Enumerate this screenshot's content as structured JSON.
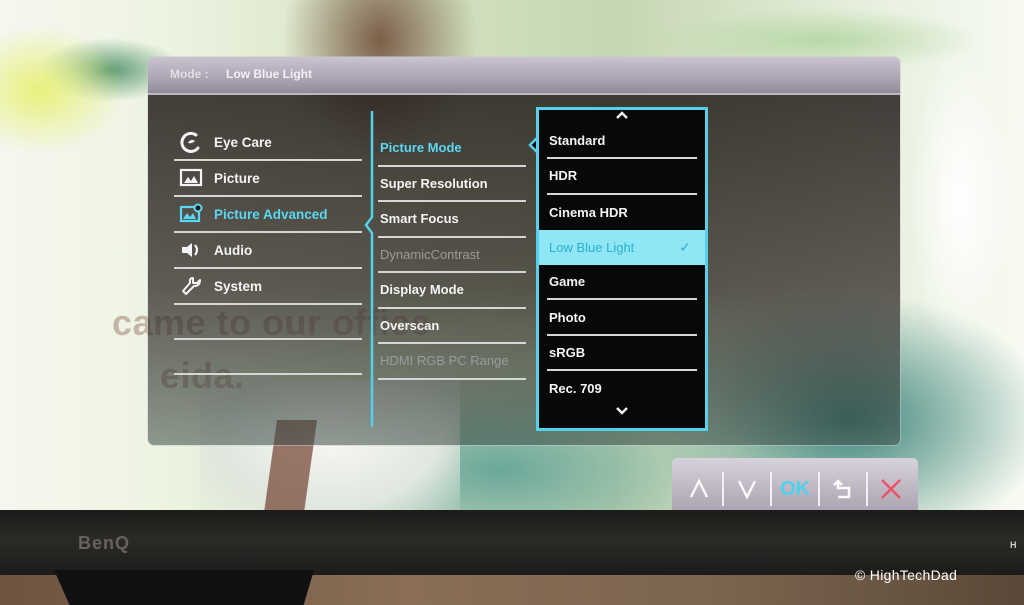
{
  "osd": {
    "header": {
      "mode_label": "Mode :",
      "mode_value": "Low Blue Light"
    },
    "main_menu": [
      {
        "label": "Eye Care",
        "icon": "eye-care-icon",
        "active": false
      },
      {
        "label": "Picture",
        "icon": "picture-icon",
        "active": false
      },
      {
        "label": "Picture Advanced",
        "icon": "picture-advanced-icon",
        "active": true
      },
      {
        "label": "Audio",
        "icon": "speaker-icon",
        "active": false
      },
      {
        "label": "System",
        "icon": "wrench-icon",
        "active": false
      }
    ],
    "sub_menu": [
      {
        "label": "Picture Mode",
        "state": "active"
      },
      {
        "label": "Super Resolution",
        "state": "normal"
      },
      {
        "label": "Smart Focus",
        "state": "normal"
      },
      {
        "label": "DynamicContrast",
        "state": "disabled"
      },
      {
        "label": "Display Mode",
        "state": "normal"
      },
      {
        "label": "Overscan",
        "state": "normal"
      },
      {
        "label": "HDMI RGB PC Range",
        "state": "disabled"
      }
    ],
    "options": {
      "scroll_up": "^",
      "scroll_down": "v",
      "items": [
        {
          "label": "Standard",
          "selected": false
        },
        {
          "label": "HDR",
          "selected": false
        },
        {
          "label": "Cinema HDR",
          "selected": false
        },
        {
          "label": "Low Blue Light",
          "selected": true
        },
        {
          "label": "Game",
          "selected": false
        },
        {
          "label": "Photo",
          "selected": false
        },
        {
          "label": "sRGB",
          "selected": false
        },
        {
          "label": "Rec. 709",
          "selected": false
        }
      ],
      "check_mark": "✓"
    }
  },
  "keybar": {
    "up": "up-key",
    "down": "down-key",
    "ok_label": "OK",
    "back": "back-key",
    "close": "close-key"
  },
  "video_subtitle": {
    "line1": "came to our office",
    "line2": "eida."
  },
  "monitor": {
    "brand": "BenQ",
    "badge": "H"
  },
  "watermark": "© HighTechDad",
  "colors": {
    "accent": "#58d8f2",
    "selected_bg": "#8fe6f4",
    "close_red": "#f0506a",
    "header_bg": "#a59fae"
  }
}
